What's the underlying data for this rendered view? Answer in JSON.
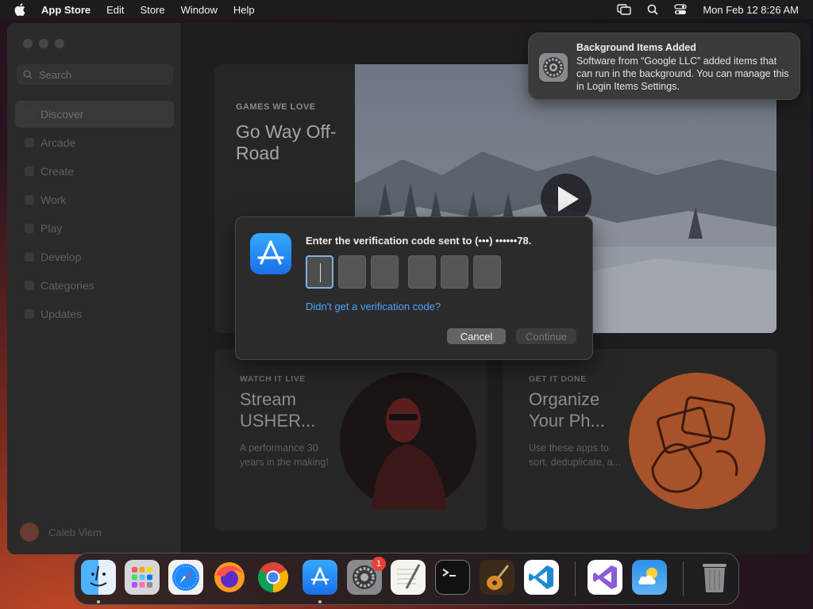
{
  "menubar": {
    "app_name": "App Store",
    "menus": [
      "Edit",
      "Store",
      "Window",
      "Help"
    ],
    "datetime": "Mon Feb 12  8:26 AM"
  },
  "sidebar": {
    "search_placeholder": "Search",
    "items": [
      {
        "label": "Discover",
        "active": true
      },
      {
        "label": "Arcade"
      },
      {
        "label": "Create"
      },
      {
        "label": "Work"
      },
      {
        "label": "Play"
      },
      {
        "label": "Develop"
      },
      {
        "label": "Categories"
      },
      {
        "label": "Updates"
      }
    ],
    "user_name": "Caleb Viem"
  },
  "hero": {
    "eyebrow": "GAMES WE LOVE",
    "title": "Go Way Off-Road"
  },
  "cards": [
    {
      "eyebrow": "WATCH IT LIVE",
      "title": "Stream USHER...",
      "desc": "A performance 30 years in the making!"
    },
    {
      "eyebrow": "GET IT DONE",
      "title": "Organize Your Ph...",
      "desc": "Use these apps to sort, deduplicate, a..."
    }
  ],
  "dialog": {
    "prompt": "Enter the verification code sent to (•••) ••••••78.",
    "link": "Didn't get a verification code?",
    "cancel_label": "Cancel",
    "continue_label": "Continue"
  },
  "notification": {
    "title": "Background Items Added",
    "body": "Software from “Google LLC” added items that can run in the background. You can manage this in Login Items Settings."
  },
  "dock": {
    "apps": [
      "finder-icon",
      "launchpad-icon",
      "safari-icon",
      "firefox-icon",
      "chrome-icon",
      "app-store-icon",
      "system-settings-icon",
      "textedit-icon",
      "terminal-icon",
      "garageband-icon",
      "vscode-icon",
      "visual-studio-icon",
      "weather-icon",
      "trash-icon"
    ],
    "settings_badge": "1"
  },
  "colors": {
    "accent": "#4ea2ff",
    "app_store_blue": "#1a8cff",
    "badge_red": "#e8403a"
  }
}
